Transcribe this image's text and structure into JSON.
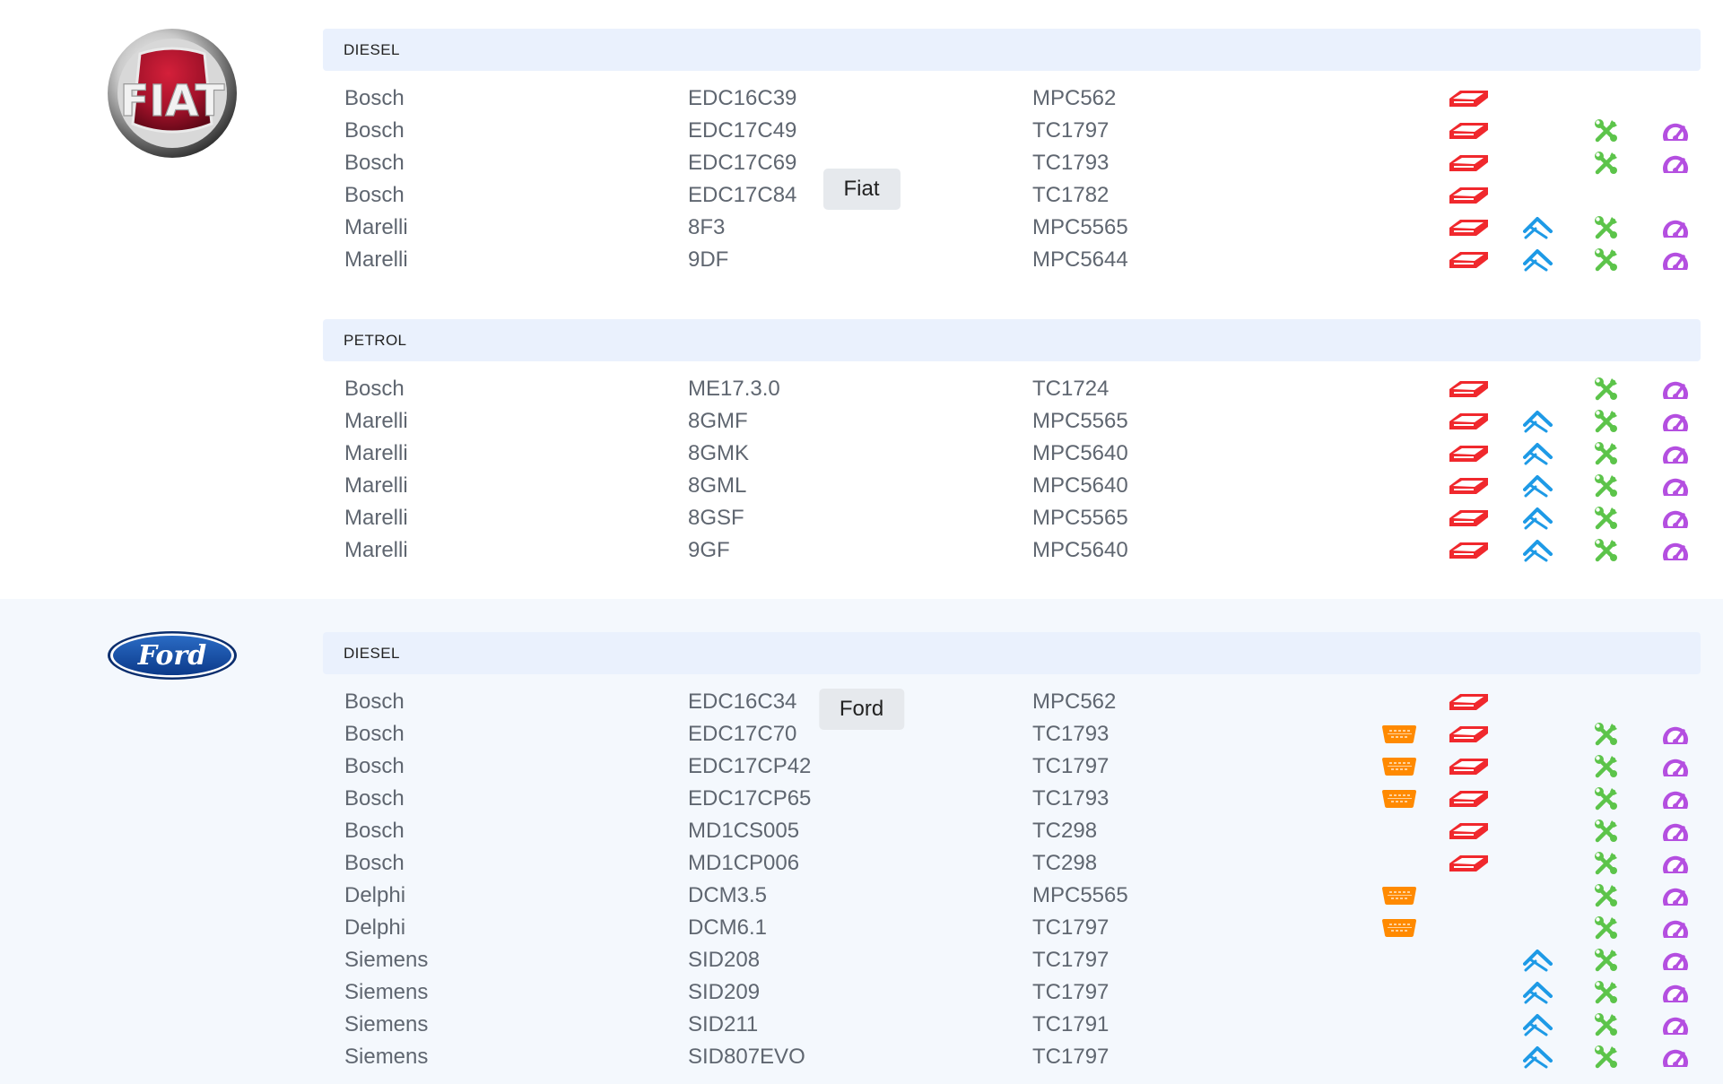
{
  "colors": {
    "obd": "#ff8a00",
    "bench": "#f0282d",
    "boot": "#1e9ae6",
    "tools": "#5cc44a",
    "tuning": "#b44fe0",
    "fuel_header_bg": "#eaf1fd",
    "ford_section_bg": "#f4f8fd"
  },
  "icons": {
    "obd": "obd-connector-icon",
    "bench": "bench-icon",
    "boot": "boot-mode-icon",
    "tools": "tools-icon",
    "tuning": "speedometer-icon"
  },
  "brands": [
    {
      "name": "Fiat",
      "logo_text": "FIAT",
      "groups": [
        {
          "fuel": "DIESEL",
          "rows": [
            {
              "brand": "Bosch",
              "ecu": "EDC16C39",
              "cpu": "MPC562",
              "obd": false,
              "bench": true,
              "boot": false,
              "tools": false,
              "tuning": false
            },
            {
              "brand": "Bosch",
              "ecu": "EDC17C49",
              "cpu": "TC1797",
              "obd": false,
              "bench": true,
              "boot": false,
              "tools": true,
              "tuning": true
            },
            {
              "brand": "Bosch",
              "ecu": "EDC17C69",
              "cpu": "TC1793",
              "obd": false,
              "bench": true,
              "boot": false,
              "tools": true,
              "tuning": true
            },
            {
              "brand": "Bosch",
              "ecu": "EDC17C84",
              "cpu": "TC1782",
              "obd": false,
              "bench": true,
              "boot": false,
              "tools": false,
              "tuning": false
            },
            {
              "brand": "Marelli",
              "ecu": "8F3",
              "cpu": "MPC5565",
              "obd": false,
              "bench": true,
              "boot": true,
              "tools": true,
              "tuning": true
            },
            {
              "brand": "Marelli",
              "ecu": "9DF",
              "cpu": "MPC5644",
              "obd": false,
              "bench": true,
              "boot": true,
              "tools": true,
              "tuning": true
            }
          ]
        },
        {
          "fuel": "PETROL",
          "rows": [
            {
              "brand": "Bosch",
              "ecu": "ME17.3.0",
              "cpu": "TC1724",
              "obd": false,
              "bench": true,
              "boot": false,
              "tools": true,
              "tuning": true
            },
            {
              "brand": "Marelli",
              "ecu": "8GMF",
              "cpu": "MPC5565",
              "obd": false,
              "bench": true,
              "boot": true,
              "tools": true,
              "tuning": true
            },
            {
              "brand": "Marelli",
              "ecu": "8GMK",
              "cpu": "MPC5640",
              "obd": false,
              "bench": true,
              "boot": true,
              "tools": true,
              "tuning": true
            },
            {
              "brand": "Marelli",
              "ecu": "8GML",
              "cpu": "MPC5640",
              "obd": false,
              "bench": true,
              "boot": true,
              "tools": true,
              "tuning": true
            },
            {
              "brand": "Marelli",
              "ecu": "8GSF",
              "cpu": "MPC5565",
              "obd": false,
              "bench": true,
              "boot": true,
              "tools": true,
              "tuning": true
            },
            {
              "brand": "Marelli",
              "ecu": "9GF",
              "cpu": "MPC5640",
              "obd": false,
              "bench": true,
              "boot": true,
              "tools": true,
              "tuning": true
            }
          ]
        }
      ]
    },
    {
      "name": "Ford",
      "logo_text": "Ford",
      "groups": [
        {
          "fuel": "DIESEL",
          "rows": [
            {
              "brand": "Bosch",
              "ecu": "EDC16C34",
              "cpu": "MPC562",
              "obd": false,
              "bench": true,
              "boot": false,
              "tools": false,
              "tuning": false
            },
            {
              "brand": "Bosch",
              "ecu": "EDC17C70",
              "cpu": "TC1793",
              "obd": true,
              "bench": true,
              "boot": false,
              "tools": true,
              "tuning": true
            },
            {
              "brand": "Bosch",
              "ecu": "EDC17CP42",
              "cpu": "TC1797",
              "obd": true,
              "bench": true,
              "boot": false,
              "tools": true,
              "tuning": true
            },
            {
              "brand": "Bosch",
              "ecu": "EDC17CP65",
              "cpu": "TC1793",
              "obd": true,
              "bench": true,
              "boot": false,
              "tools": true,
              "tuning": true
            },
            {
              "brand": "Bosch",
              "ecu": "MD1CS005",
              "cpu": "TC298",
              "obd": false,
              "bench": true,
              "boot": false,
              "tools": true,
              "tuning": true
            },
            {
              "brand": "Bosch",
              "ecu": "MD1CP006",
              "cpu": "TC298",
              "obd": false,
              "bench": true,
              "boot": false,
              "tools": true,
              "tuning": true
            },
            {
              "brand": "Delphi",
              "ecu": "DCM3.5",
              "cpu": "MPC5565",
              "obd": true,
              "bench": false,
              "boot": false,
              "tools": true,
              "tuning": true
            },
            {
              "brand": "Delphi",
              "ecu": "DCM6.1",
              "cpu": "TC1797",
              "obd": true,
              "bench": false,
              "boot": false,
              "tools": true,
              "tuning": true
            },
            {
              "brand": "Siemens",
              "ecu": "SID208",
              "cpu": "TC1797",
              "obd": false,
              "bench": false,
              "boot": true,
              "tools": true,
              "tuning": true
            },
            {
              "brand": "Siemens",
              "ecu": "SID209",
              "cpu": "TC1797",
              "obd": false,
              "bench": false,
              "boot": true,
              "tools": true,
              "tuning": true
            },
            {
              "brand": "Siemens",
              "ecu": "SID211",
              "cpu": "TC1791",
              "obd": false,
              "bench": false,
              "boot": true,
              "tools": true,
              "tuning": true
            },
            {
              "brand": "Siemens",
              "ecu": "SID807EVO",
              "cpu": "TC1797",
              "obd": false,
              "bench": false,
              "boot": true,
              "tools": true,
              "tuning": true
            }
          ]
        }
      ]
    }
  ]
}
